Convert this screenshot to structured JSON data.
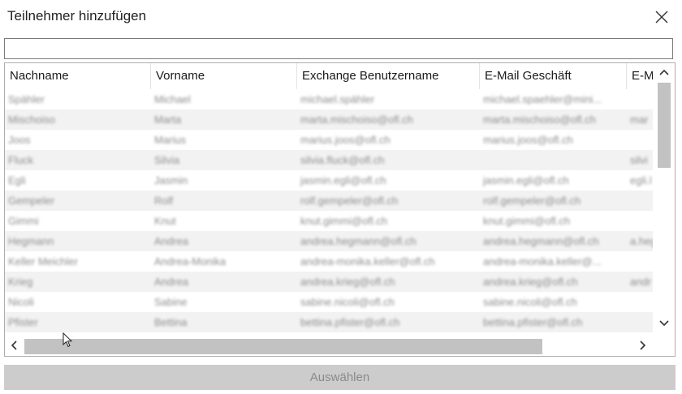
{
  "dialog": {
    "title": "Teilnehmer hinzufügen",
    "close_glyph": "✕"
  },
  "search": {
    "value": "",
    "placeholder": ""
  },
  "columns": [
    "Nachname",
    "Vorname",
    "Exchange Benutzername",
    "E-Mail Geschäft",
    "E-M"
  ],
  "rows": [
    [
      "Spähler",
      "Michael",
      "michael.spähler",
      "michael.spaehler@mini...",
      ""
    ],
    [
      "Mischoiso",
      "Marta",
      "marta.mischoiso@ofl.ch",
      "marta.mischoiso@ofl.ch",
      "mar"
    ],
    [
      "Joos",
      "Marius",
      "marius.joos@ofl.ch",
      "marius.joos@ofl.ch",
      ""
    ],
    [
      "Fluck",
      "Silvia",
      "silvia.fluck@ofl.ch",
      "",
      "silvi"
    ],
    [
      "Egli",
      "Jasmin",
      "jasmin.egli@ofl.ch",
      "jasmin.egli@ofl.ch",
      "egli.l"
    ],
    [
      "Gempeler",
      "Rolf",
      "rolf.gempeler@ofl.ch",
      "rolf.gempeler@ofl.ch",
      ""
    ],
    [
      "Gimmi",
      "Knut",
      "knut.gimmi@ofl.ch",
      "knut.gimmi@ofl.ch",
      ""
    ],
    [
      "Hegmann",
      "Andrea",
      "andrea.hegmann@ofl.ch",
      "andrea.hegmann@ofl.ch",
      "a.heg"
    ],
    [
      "Keller Meichler",
      "Andrea-Monika",
      "andrea-monika.keller@ofl.ch",
      "andrea-monika.keller@...",
      ""
    ],
    [
      "Krieg",
      "Andrea",
      "andrea.krieg@ofl.ch",
      "andrea.krieg@ofl.ch",
      "andr"
    ],
    [
      "Nicoli",
      "Sabine",
      "sabine.nicoli@ofl.ch",
      "sabine.nicoli@ofl.ch",
      ""
    ],
    [
      "Pfister",
      "Bettina",
      "bettina.pfister@ofl.ch",
      "bettina.pfister@ofl.ch",
      ""
    ]
  ],
  "scrollbars": {
    "up": "▲",
    "down": "▼",
    "left": "◀",
    "right": "▶"
  },
  "button": {
    "select_label": "Auswählen"
  }
}
